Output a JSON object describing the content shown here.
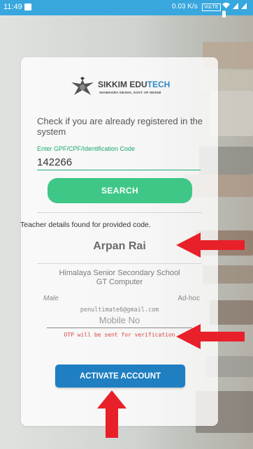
{
  "status_bar": {
    "time": "11:49",
    "network_speed": "0.03 K/s",
    "volte": "VoLTE"
  },
  "logo": {
    "title_main": "SIKKIM EDU",
    "title_accent": "TECH",
    "subtitle": "SHAMAGRA SIKSHA, GOVT. OF SIKKIM"
  },
  "registration": {
    "prompt": "Check if you are already registered in the system",
    "code_label": "Enter GPF/CPF/Identification Code",
    "code_value": "142266",
    "search_label": "SEARCH"
  },
  "teacher": {
    "found_message": "Teacher details found for provided code.",
    "name": "Arpan Rai",
    "school": "Himalaya Senior Secondary School",
    "subject": "GT Computer",
    "gender": "Male",
    "employment_type": "Ad-hoc",
    "email": "penultimate6@gmail.com"
  },
  "activation": {
    "mobile_placeholder": "Mobile No",
    "otp_note": "OTP will be sent for verification",
    "activate_label": "ACTIVATE ACCOUNT"
  },
  "colors": {
    "status_bar": "#38a7de",
    "accent_green": "#3ec787",
    "primary_blue": "#1f7fc1",
    "annotation_red": "#e8202a"
  }
}
